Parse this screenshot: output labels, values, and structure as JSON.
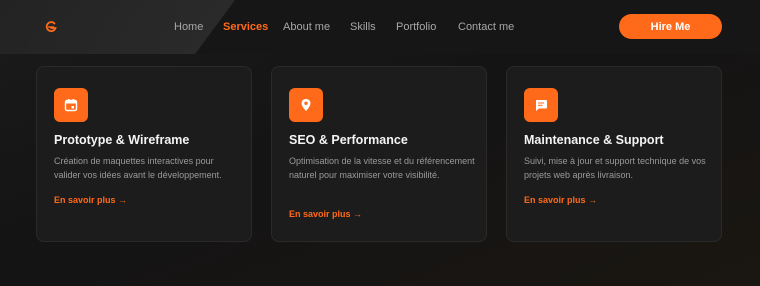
{
  "nav": {
    "items": [
      {
        "label": "Home"
      },
      {
        "label": "Services"
      },
      {
        "label": "About me"
      },
      {
        "label": "Skills"
      },
      {
        "label": "Portfolio"
      },
      {
        "label": "Contact me"
      }
    ],
    "active": "Services",
    "hire_label": "Hire Me"
  },
  "colors": {
    "accent": "#ff6a1a",
    "background": "#161616",
    "card": "#1c1c1c"
  },
  "services": [
    {
      "icon": "calendar-icon",
      "title": "Prototype & Wireframe",
      "description": "Création de maquettes interactives pour valider vos idées avant le développement.",
      "link": "En savoir plus →"
    },
    {
      "icon": "location-pin-icon",
      "title": "SEO & Performance",
      "description": "Optimisation de la vitesse et du référencement naturel pour maximiser votre visibilité.",
      "link": "En savoir plus →"
    },
    {
      "icon": "chat-icon",
      "title": "Maintenance & Support",
      "description": "Suivi, mise à jour et support technique de vos projets web après livraison.",
      "link": "En savoir plus →"
    }
  ]
}
